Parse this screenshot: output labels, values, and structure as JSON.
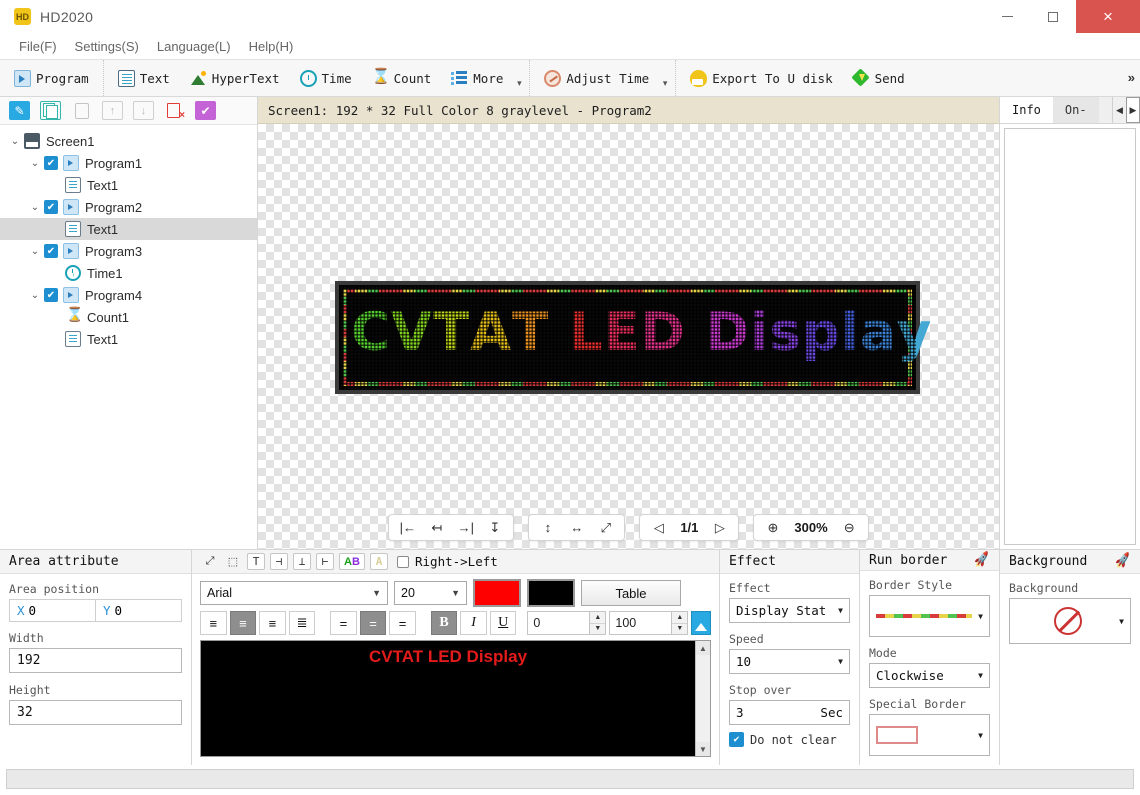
{
  "window": {
    "title": "HD2020",
    "icon": "app-logo-icon",
    "minimize": "—",
    "maximize": "□",
    "close": "×"
  },
  "menubar": {
    "items": [
      {
        "label": "File(F)"
      },
      {
        "label": "Settings(S)"
      },
      {
        "label": "Language(L)"
      },
      {
        "label": "Help(H)"
      }
    ]
  },
  "ribbon": {
    "overflow": "»",
    "groups": [
      {
        "buttons": [
          {
            "label": "Program",
            "icon": "program-icon"
          }
        ]
      },
      {
        "buttons": [
          {
            "label": "Text",
            "icon": "text-icon"
          },
          {
            "label": "HyperText",
            "icon": "hypertext-icon"
          },
          {
            "label": "Time",
            "icon": "time-icon"
          },
          {
            "label": "Count",
            "icon": "count-icon"
          },
          {
            "label": "More",
            "icon": "more-icon",
            "caret": "▾"
          }
        ]
      },
      {
        "buttons": [
          {
            "label": "Adjust Time",
            "icon": "adjust-time-icon",
            "caret": "▾"
          }
        ]
      },
      {
        "buttons": [
          {
            "label": "Export To U disk",
            "icon": "export-icon"
          },
          {
            "label": "Send",
            "icon": "send-icon"
          }
        ]
      }
    ]
  },
  "tree": {
    "toolbar": [
      {
        "name": "add-program-button",
        "glyph": "✎"
      },
      {
        "name": "copy-button",
        "glyph": ""
      },
      {
        "name": "paste-button",
        "glyph": ""
      },
      {
        "name": "move-up-button",
        "glyph": "↑"
      },
      {
        "name": "move-down-button",
        "glyph": "↓"
      },
      {
        "name": "delete-button",
        "glyph": ""
      },
      {
        "name": "apply-button",
        "glyph": "✔"
      }
    ],
    "nodes": [
      {
        "label": "Screen1",
        "indent": 0,
        "twisty": "⌄",
        "checkbox": false,
        "icon": "screen-icon",
        "selected": false
      },
      {
        "label": "Program1",
        "indent": 1,
        "twisty": "⌄",
        "checkbox": true,
        "icon": "program-icon",
        "selected": false
      },
      {
        "label": "Text1",
        "indent": 2,
        "twisty": "",
        "checkbox": false,
        "icon": "text-icon",
        "selected": false
      },
      {
        "label": "Program2",
        "indent": 1,
        "twisty": "⌄",
        "checkbox": true,
        "icon": "program-icon",
        "selected": false
      },
      {
        "label": "Text1",
        "indent": 2,
        "twisty": "",
        "checkbox": false,
        "icon": "text-icon",
        "selected": true
      },
      {
        "label": "Program3",
        "indent": 1,
        "twisty": "⌄",
        "checkbox": true,
        "icon": "program-icon",
        "selected": false
      },
      {
        "label": "Time1",
        "indent": 2,
        "twisty": "",
        "checkbox": false,
        "icon": "time-icon",
        "selected": false
      },
      {
        "label": "Program4",
        "indent": 1,
        "twisty": "⌄",
        "checkbox": true,
        "icon": "program-icon",
        "selected": false
      },
      {
        "label": "Count1",
        "indent": 2,
        "twisty": "",
        "checkbox": false,
        "icon": "count-icon",
        "selected": false
      },
      {
        "label": "Text1",
        "indent": 2,
        "twisty": "",
        "checkbox": false,
        "icon": "text-icon",
        "selected": false
      }
    ]
  },
  "canvas": {
    "header": "Screen1: 192 * 32 Full Color 8 graylevel - Program2",
    "led_text": "CVTAT LED Display",
    "led_letters": [
      {
        "ch": "C",
        "color": "#56d12e"
      },
      {
        "ch": "V",
        "color": "#86d81f"
      },
      {
        "ch": "T",
        "color": "#c4dc16"
      },
      {
        "ch": "A",
        "color": "#e8c119"
      },
      {
        "ch": "T",
        "color": "#f09421"
      },
      {
        "ch": " ",
        "color": "#ffffff"
      },
      {
        "ch": "L",
        "color": "#ef2f2f"
      },
      {
        "ch": "E",
        "color": "#ef2f5f"
      },
      {
        "ch": "D",
        "color": "#e8338f"
      },
      {
        "ch": " ",
        "color": "#ffffff"
      },
      {
        "ch": "D",
        "color": "#cf3ad3"
      },
      {
        "ch": "i",
        "color": "#b33fe0"
      },
      {
        "ch": "s",
        "color": "#8a44e8"
      },
      {
        "ch": "p",
        "color": "#6a4be8"
      },
      {
        "ch": "l",
        "color": "#4560e0"
      },
      {
        "ch": "a",
        "color": "#3d86da"
      },
      {
        "ch": "y",
        "color": "#44a8d4"
      }
    ],
    "toolbar": {
      "align_left": "|←",
      "align_top": "↤",
      "align_right": "→|",
      "align_bottom": "↧",
      "fit_height": "↕",
      "fit_width": "↔",
      "fit_screen": "⤢",
      "prev_page": "◁",
      "page_indicator": "1/1",
      "next_page": "▷",
      "zoom_in": "⊕",
      "zoom_level": "300%",
      "zoom_out": "⊖"
    }
  },
  "info": {
    "tabs": [
      {
        "label": "Info",
        "active": true
      },
      {
        "label": "On-",
        "active": false
      }
    ],
    "arrow_left": "◀",
    "arrow_right": "▶"
  },
  "area_attribute": {
    "title": "Area attribute",
    "position_label": "Area position",
    "x_label": "X",
    "x_value": "0",
    "y_label": "Y",
    "y_value": "0",
    "width_label": "Width",
    "width_value": "192",
    "height_label": "Height",
    "height_value": "32"
  },
  "text_editor": {
    "toolbar_top": {
      "expand_icon": "expand-icon",
      "select_icon": "select-region-icon",
      "text_icon": "T",
      "align_h_icon": "⊣",
      "align_v_icon": "⊥",
      "align_w_icon": "⊢",
      "color_ab": "AB",
      "outline_a": "A",
      "rtl_checkbox_checked": false,
      "rtl_label": "Right->Left"
    },
    "font_family": "Arial",
    "font_size": "20",
    "foreground_color": "#ff0000",
    "background_color": "#000000",
    "table_button": "Table",
    "align_buttons": [
      {
        "name": "align-left-button",
        "active": false
      },
      {
        "name": "align-center-button",
        "active": true
      },
      {
        "name": "align-right-button",
        "active": false
      },
      {
        "name": "align-justify-button",
        "active": false
      }
    ],
    "valign_buttons": [
      {
        "name": "valign-top-button",
        "active": false
      },
      {
        "name": "valign-middle-button",
        "active": true
      },
      {
        "name": "valign-bottom-button",
        "active": false
      }
    ],
    "bold": {
      "label": "B",
      "active": true
    },
    "italic": {
      "label": "I",
      "active": false
    },
    "underline": {
      "label": "U",
      "active": false
    },
    "spacing_value": "0",
    "scale_value": "100",
    "insert_image_icon": "insert-image-icon",
    "preview_text": "CVTAT LED Display",
    "scroll_up": "▲",
    "scroll_down": "▼"
  },
  "effect": {
    "title": "Effect",
    "effect_label": "Effect",
    "effect_value": "Display Stat",
    "speed_label": "Speed",
    "speed_value": "10",
    "stopover_label": "Stop over",
    "stopover_value": "3",
    "stopover_unit": "Sec",
    "donotclear_label": "Do not clear",
    "donotclear_checked": true
  },
  "run_border": {
    "title": "Run border",
    "rocket_icon": "rocket-icon",
    "border_style_label": "Border Style",
    "mode_label": "Mode",
    "mode_value": "Clockwise",
    "special_border_label": "Special Border"
  },
  "background": {
    "title": "Background",
    "rocket_icon": "rocket-icon",
    "background_label": "Background",
    "background_value": "none"
  }
}
